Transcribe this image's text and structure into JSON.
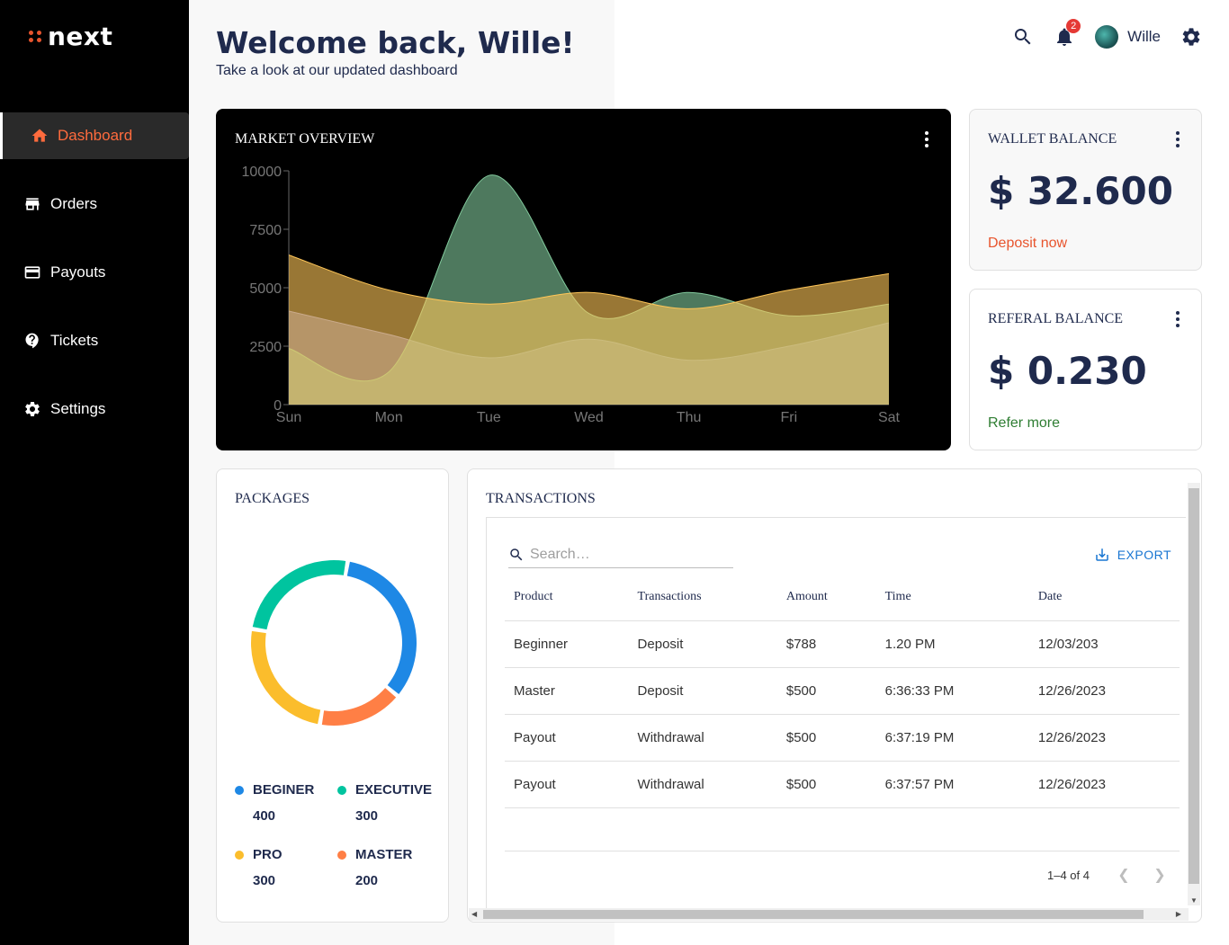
{
  "app": {
    "logo_text": "next"
  },
  "sidebar": {
    "items": [
      {
        "label": "Dashboard",
        "icon": "home-icon",
        "active": true
      },
      {
        "label": "Orders",
        "icon": "store-icon"
      },
      {
        "label": "Payouts",
        "icon": "credit-card-icon"
      },
      {
        "label": "Tickets",
        "icon": "help-icon"
      },
      {
        "label": "Settings",
        "icon": "gear-icon"
      }
    ]
  },
  "header": {
    "title": "Welcome back, Wille!",
    "subtitle": "Take a look at our updated dashboard",
    "notifications_count": "2",
    "username": "Wille"
  },
  "market": {
    "title": "MARKET OVERVIEW",
    "chart_data": {
      "type": "area",
      "categories": [
        "Sun",
        "Mon",
        "Tue",
        "Wed",
        "Thu",
        "Fri",
        "Sat"
      ],
      "ylim": [
        0,
        10000
      ],
      "yticks": [
        0,
        2500,
        5000,
        7500,
        10000
      ],
      "series": [
        {
          "values": [
            4000,
            3000,
            2000,
            2800,
            1900,
            2500,
            3500
          ],
          "color": "#7a7fd4"
        },
        {
          "values": [
            2400,
            1400,
            9800,
            3900,
            4800,
            3800,
            4300
          ],
          "color": "#82ca9d"
        },
        {
          "values": [
            6400,
            4900,
            4300,
            4800,
            4100,
            4900,
            5600
          ],
          "color": "#ffc658"
        }
      ]
    }
  },
  "wallet": {
    "title": "WALLET BALANCE",
    "amount": "$ 32.600",
    "link": "Deposit now",
    "link_color": "#e8542d"
  },
  "referal": {
    "title": "REFERAL BALANCE",
    "amount": "$ 0.230",
    "link": "Refer more",
    "link_color": "#2e7d32"
  },
  "packages": {
    "title": "PACKAGES",
    "chart_data": {
      "type": "pie",
      "categories": [
        "BEGINER",
        "MASTER",
        "PRO",
        "EXECUTIVE"
      ],
      "values": [
        400,
        200,
        300,
        300
      ],
      "colors": [
        "#1e88e5",
        "#ff7f45",
        "#fbbd2c",
        "#00c49f"
      ]
    },
    "legend": [
      {
        "label": "BEGINER",
        "value": "400",
        "color": "#1e88e5"
      },
      {
        "label": "EXECUTIVE",
        "value": "300",
        "color": "#00c49f"
      },
      {
        "label": "PRO",
        "value": "300",
        "color": "#fbbd2c"
      },
      {
        "label": "MASTER",
        "value": "200",
        "color": "#ff7f45"
      }
    ]
  },
  "transactions": {
    "title": "TRANSACTIONS",
    "search_placeholder": "Search…",
    "export_label": "EXPORT",
    "columns": [
      "Product",
      "Transactions",
      "Amount",
      "Time",
      "Date"
    ],
    "rows": [
      [
        "Beginner",
        "Deposit",
        "$788",
        "1.20 PM",
        "12/03/203"
      ],
      [
        "Master",
        "Deposit",
        "$500",
        "6:36:33 PM",
        "12/26/2023"
      ],
      [
        "Payout",
        "Withdrawal",
        "$500",
        "6:37:19 PM",
        "12/26/2023"
      ],
      [
        "Payout",
        "Withdrawal",
        "$500",
        "6:37:57 PM",
        "12/26/2023"
      ]
    ],
    "pagination": "1–4 of 4"
  }
}
